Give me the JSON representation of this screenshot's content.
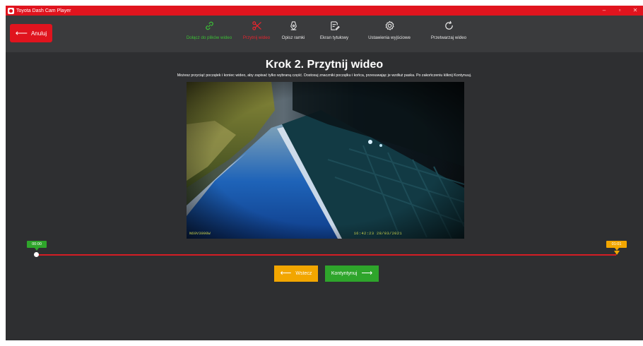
{
  "window": {
    "title": "Toyota Dash Cam Player",
    "controls": {
      "minimize": "–",
      "maximize": "▫",
      "close": "✕"
    }
  },
  "toolbar": {
    "cancel_label": "Anuluj",
    "cancel_icon": "arrow-left-icon",
    "steps": [
      {
        "label": "Dołącz do plików wideo",
        "icon": "link-icon",
        "state": "done",
        "color": "#3bbf36"
      },
      {
        "label": "Przytnij wideo",
        "icon": "scissors-icon",
        "state": "active",
        "color": "#e8242e"
      },
      {
        "label": "Opisz ramki",
        "icon": "pen-nib-icon",
        "state": "pending",
        "color": "#e6e6e6"
      },
      {
        "label": "Ekran tytułowy",
        "icon": "edit-document-icon",
        "state": "pending",
        "color": "#e6e6e6"
      },
      {
        "label": "Ustawienia wyjściowe",
        "icon": "gear-icon",
        "state": "pending",
        "color": "#e6e6e6"
      },
      {
        "label": "Przetwarzaj wideo",
        "icon": "refresh-icon",
        "state": "pending",
        "color": "#e6e6e6"
      }
    ]
  },
  "main": {
    "title": "Krok 2. Przytnij wideo",
    "instructions": "Możesz przyciąć początek i koniec wideo, aby zapisać tylko wybraną część. Dostosuj znaczniki początku i końca, przesuwając je wzdłuż paska. Po zakończeniu kliknij Kontynuuj."
  },
  "video": {
    "overlay_left": "N60V3900W",
    "overlay_right": "16:42:23 28/03/2021"
  },
  "timeline": {
    "start_label": "00:00",
    "end_label": "01:01",
    "start_fraction": 0,
    "end_fraction": 1
  },
  "buttons": {
    "back_label": "Wstecz",
    "next_label": "Kontyntynuj"
  },
  "colors": {
    "brand_red": "#e0141e",
    "background": "#2e2f31",
    "toolbar": "#3a3b3d",
    "start_green": "#2fa52b",
    "end_orange": "#f2a600",
    "track_red": "#d51d24"
  }
}
